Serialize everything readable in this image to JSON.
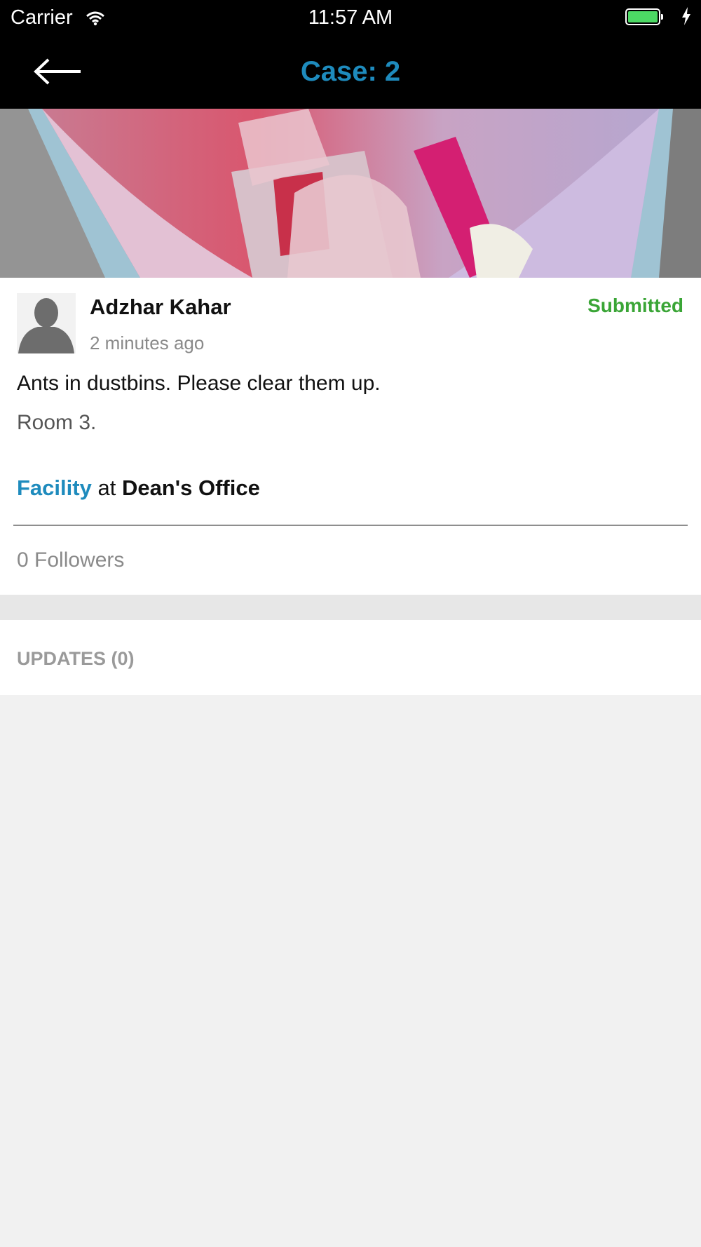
{
  "status_bar": {
    "carrier": "Carrier",
    "time": "11:57 AM",
    "battery_color": "#4cd964"
  },
  "nav": {
    "back_icon": "arrow-left-icon",
    "title": "Case: 2",
    "title_color": "#1e8bbd"
  },
  "case": {
    "author": "Adzhar Kahar",
    "time_ago": "2 minutes ago",
    "status": "Submitted",
    "status_color": "#3aa536",
    "description": "Ants in dustbins. Please clear them up.",
    "room": "Room 3.",
    "category": "Facility",
    "at_text": "at",
    "location": "Dean's Office",
    "followers": "0 Followers"
  },
  "updates": {
    "label": "UPDATES (0)"
  }
}
